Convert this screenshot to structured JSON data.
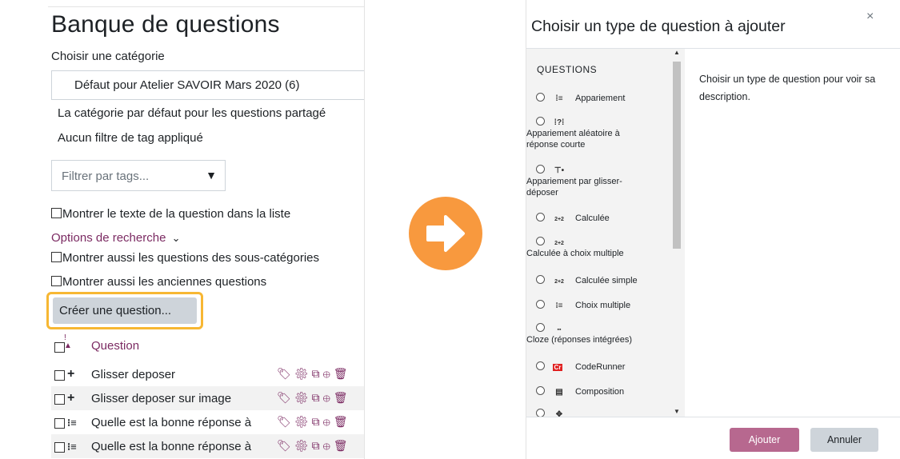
{
  "left": {
    "title": "Banque de questions",
    "category_label": "Choisir une catégorie",
    "category_value": "Défaut pour Atelier SAVOIR Mars 2020 (6)",
    "category_desc": "La catégorie par défaut pour les questions partagé",
    "no_tag_filter": "Aucun filtre de tag appliqué",
    "tag_placeholder": "Filtrer par tags...",
    "show_text": "Montrer le texte de la question dans la liste",
    "search_options": "Options de recherche",
    "show_subcats": "Montrer aussi les questions des sous-catégories",
    "show_old": "Montrer aussi les anciennes questions",
    "create_button": "Créer une question...",
    "col_question": "Question",
    "rows": [
      {
        "type_icon": "+",
        "name": "Glisser deposer"
      },
      {
        "type_icon": "+",
        "name": "Glisser deposer sur image"
      },
      {
        "type_icon": "⁝≡",
        "name": "Quelle est la bonne réponse à"
      },
      {
        "type_icon": "⁝≡",
        "name": "Quelle est la bonne réponse à"
      }
    ],
    "action_icons": [
      "tag-icon",
      "gear-icon",
      "duplicate-icon",
      "preview-icon",
      "delete-icon"
    ]
  },
  "modal": {
    "title": "Choisir un type de question à ajouter",
    "close": "×",
    "section": "QUESTIONS",
    "types": [
      {
        "icon": "⁞≡",
        "label": "Appariement"
      },
      {
        "icon": "⁞?⁞",
        "label": "Appariement aléatoire à réponse courte"
      },
      {
        "icon": "⊤•",
        "label": "Appariement par glisser-déposer"
      },
      {
        "icon": "2+2",
        "label": "Calculée"
      },
      {
        "icon": "2+2",
        "label": "Calculée à choix multiple"
      },
      {
        "icon": "2+2",
        "label": "Calculée simple"
      },
      {
        "icon": "⁝≡",
        "label": "Choix multiple"
      },
      {
        "icon": "▪▪",
        "label": "Cloze (réponses intégrées)"
      },
      {
        "icon": "Cr",
        "label": "CodeRunner"
      },
      {
        "icon": "▤",
        "label": "Composition"
      },
      {
        "icon": "✥",
        "label": ""
      }
    ],
    "description": "Choisir un type de question pour voir sa description.",
    "add_button": "Ajouter",
    "cancel_button": "Annuler"
  },
  "colors": {
    "accent": "#7b2a62",
    "highlight": "#f7b733",
    "arrow": "#f8993e",
    "add_button": "#b7688f"
  }
}
